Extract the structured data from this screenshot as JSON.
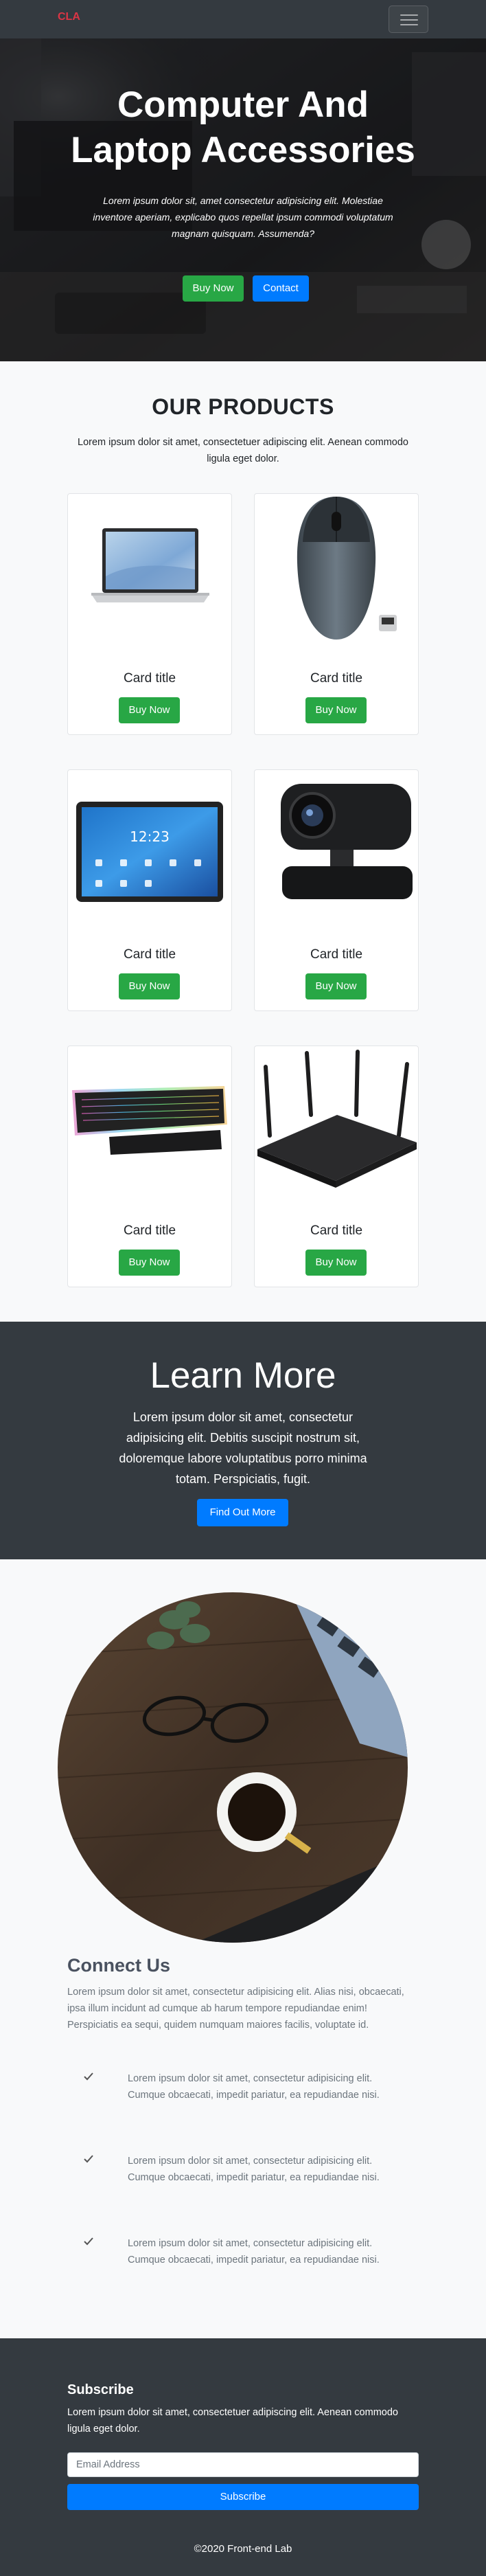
{
  "navbar": {
    "brand": "CLA",
    "toggler_icon": "hamburger-menu-icon"
  },
  "hero": {
    "title_line1": "Computer And",
    "title_line2": "Laptop Accessories",
    "text": "Lorem ipsum dolor sit, amet consectetur adipisicing elit. Molestiae inventore aperiam, explicabo quos repellat ipsum commodi voluptatum magnam quisquam. Assumenda?",
    "buy_label": "Buy Now",
    "contact_label": "Contact"
  },
  "products": {
    "title": "OUR PRODUCTS",
    "text": "Lorem ipsum dolor sit amet, consectetuer adipiscing elit. Aenean commodo ligula eget dolor.",
    "cards": [
      {
        "image": "laptop",
        "title": "Card title",
        "button": "Buy Now"
      },
      {
        "image": "mouse",
        "title": "Card title",
        "button": "Buy Now"
      },
      {
        "image": "tablet",
        "title": "Card title",
        "button": "Buy Now"
      },
      {
        "image": "webcam",
        "title": "Card title",
        "button": "Buy Now"
      },
      {
        "image": "keyboard",
        "title": "Card title",
        "button": "Buy Now"
      },
      {
        "image": "router",
        "title": "Card title",
        "button": "Buy Now"
      }
    ]
  },
  "learn": {
    "title": "Learn More",
    "text": "Lorem ipsum dolor sit amet, consectetur adipisicing elit. Debitis suscipit nostrum sit, doloremque labore voluptatibus porro minima totam. Perspiciatis, fugit.",
    "button": "Find Out More"
  },
  "connect": {
    "title": "Connect Us",
    "text": "Lorem ipsum dolor sit amet, consectetur adipisicing elit. Alias nisi, obcaecati, ipsa illum incidunt ad cumque ab harum tempore repudiandae enim! Perspiciatis ea sequi, quidem numquam maiores facilis, voluptate id.",
    "features": [
      {
        "icon": "check-icon",
        "text": "Lorem ipsum dolor sit amet, consectetur adipisicing elit. Cumque obcaecati, impedit pariatur, ea repudiandae nisi."
      },
      {
        "icon": "check-icon",
        "text": "Lorem ipsum dolor sit amet, consectetur adipisicing elit. Cumque obcaecati, impedit pariatur, ea repudiandae nisi."
      },
      {
        "icon": "check-icon",
        "text": "Lorem ipsum dolor sit amet, consectetur adipisicing elit. Cumque obcaecati, impedit pariatur, ea repudiandae nisi."
      }
    ]
  },
  "subscribe": {
    "title": "Subscribe",
    "text": "Lorem ipsum dolor sit amet, consectetuer adipiscing elit. Aenean commodo ligula eget dolor.",
    "placeholder": "Email Address",
    "button": "Subscribe",
    "copyright": "©2020 Front-end Lab"
  },
  "colors": {
    "dark": "#343a40",
    "green": "#28a745",
    "blue": "#007bff",
    "brand": "#dc3545"
  }
}
